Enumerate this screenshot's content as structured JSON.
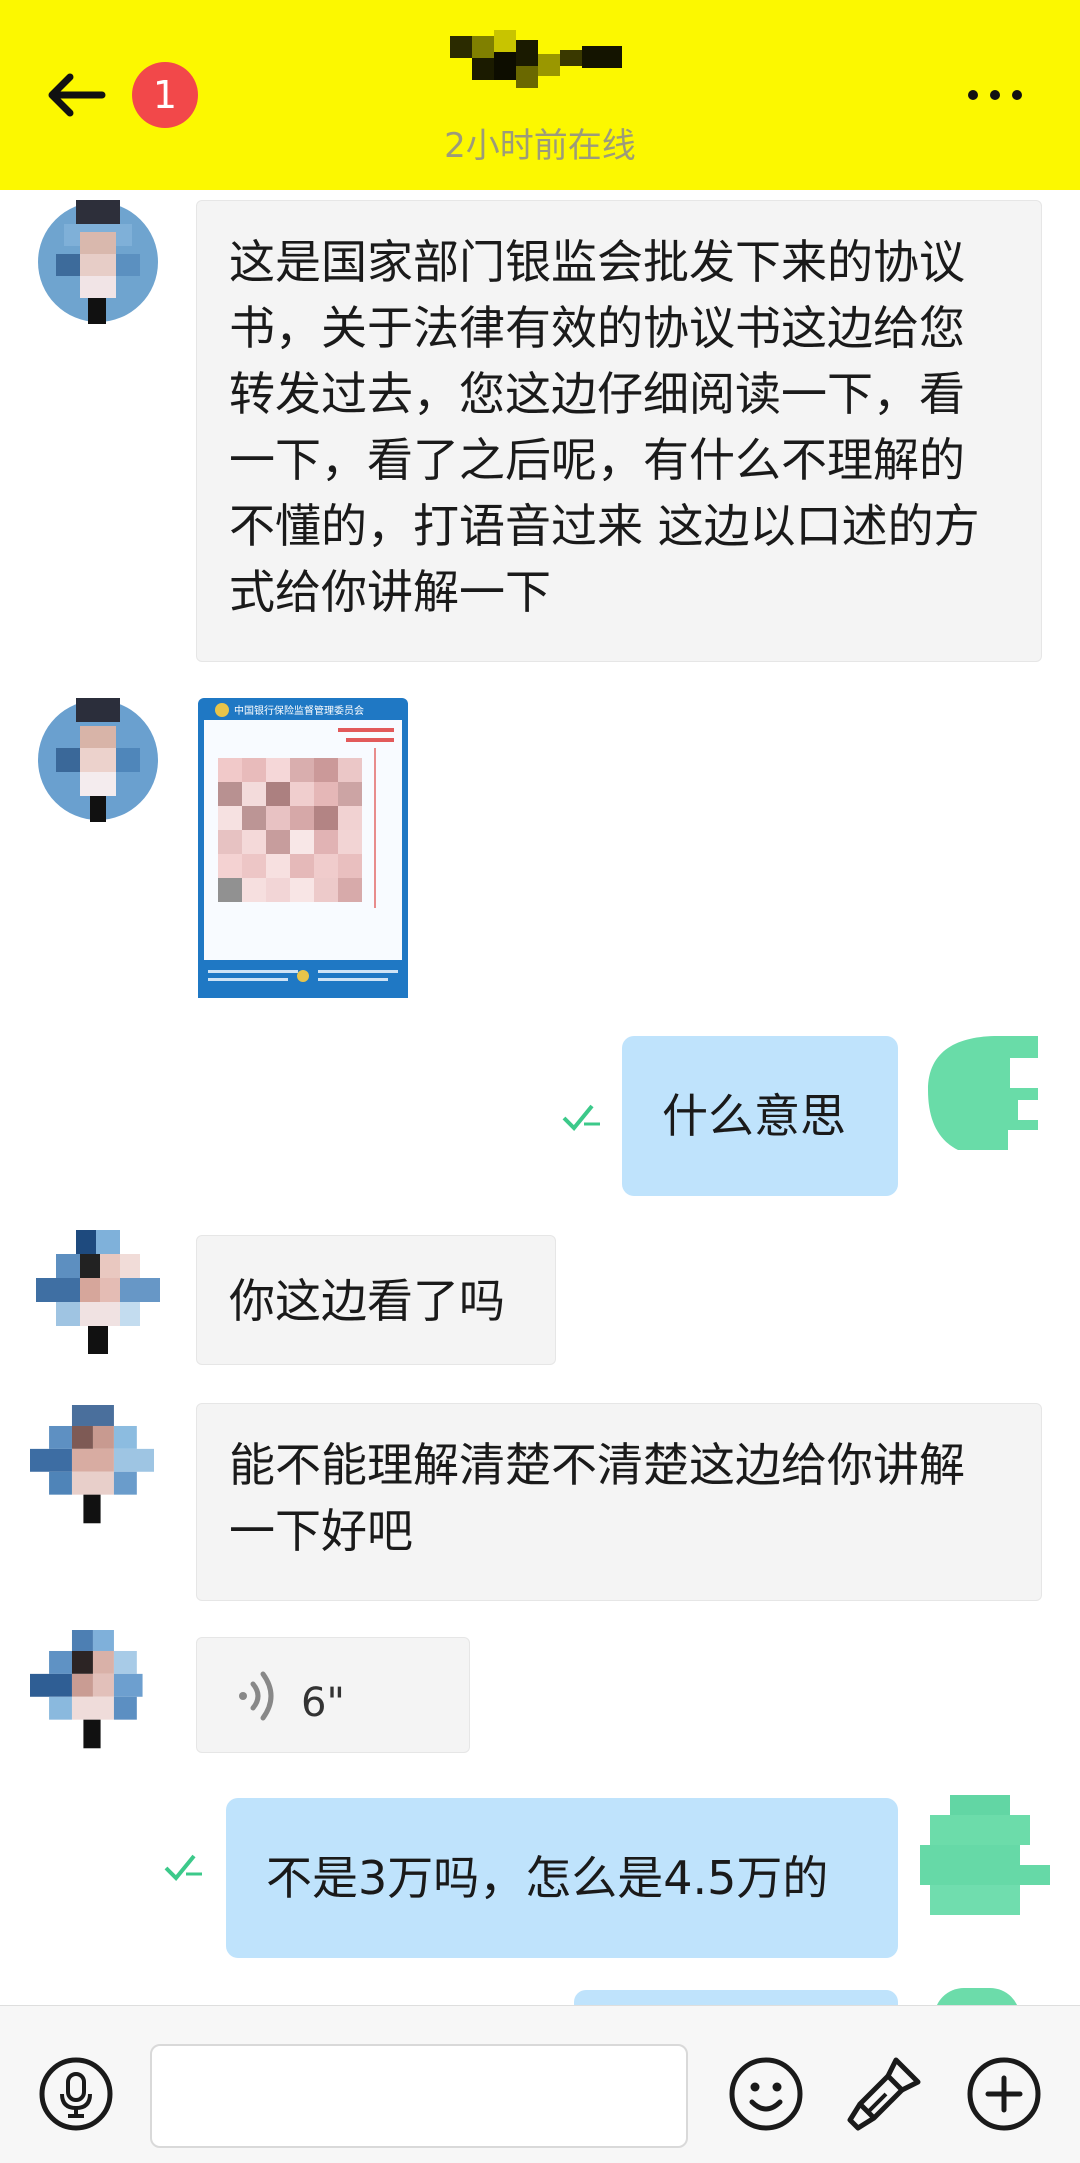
{
  "header": {
    "unread_count": "1",
    "status": "2小时前在线"
  },
  "messages": [
    {
      "side": "in",
      "type": "text",
      "text": "这是国家部门银监会批发下来的协议书，关于法律有效的协议书这边给您转发过去，您这边仔细阅读一下，看一下，看了之后呢，有什么不理解的不懂的，打语音过来 这边以口述的方式给你讲解一下"
    },
    {
      "side": "in",
      "type": "image",
      "caption_top": "中国银行保险监督管理委员会"
    },
    {
      "side": "out",
      "type": "text",
      "text": "什么意思"
    },
    {
      "side": "in",
      "type": "text",
      "text": "你这边看了吗"
    },
    {
      "side": "in",
      "type": "text",
      "text": "能不能理解清楚不清楚这边给你讲解一下好吧"
    },
    {
      "side": "in",
      "type": "voice",
      "duration": "6\""
    },
    {
      "side": "out",
      "type": "text",
      "text": "不是3万吗，怎么是4.5万的"
    }
  ],
  "colors": {
    "header_bg": "#fcf800",
    "badge": "#f2484a",
    "outgoing_bubble": "#bfe3fc",
    "incoming_bubble": "#f4f4f4",
    "read_check": "#3cc98a"
  },
  "icons": {
    "back": "arrow-left-icon",
    "more": "more-dots-icon",
    "read": "read-check-icon",
    "voice": "voice-wave-icon",
    "mic": "microphone-icon",
    "emoji": "emoji-icon",
    "brush": "brush-icon",
    "plus": "plus-icon"
  }
}
